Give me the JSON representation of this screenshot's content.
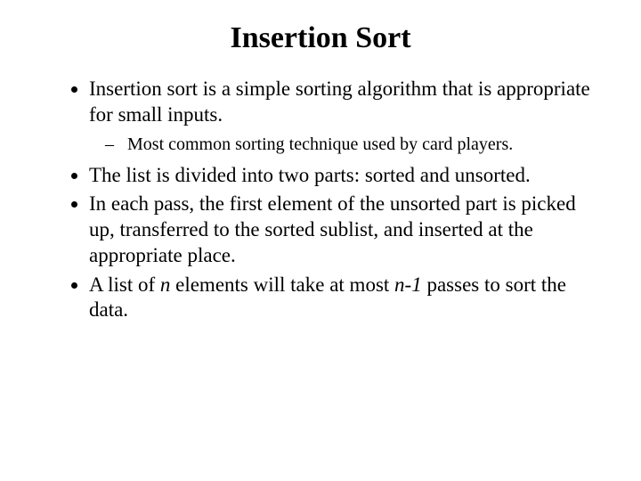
{
  "title": "Insertion Sort",
  "bullets": {
    "b1": "Insertion sort is a simple sorting algorithm that is appropriate for small inputs.",
    "b1_sub": "Most common sorting technique used by card players.",
    "b2": "The list is divided into two parts: sorted and unsorted.",
    "b3": "In each pass, the first element of the unsorted part is picked up, transferred to the sorted sublist, and inserted at the appropriate place.",
    "b4_pre": "A list of ",
    "b4_n": "n",
    "b4_mid": " elements will take at most ",
    "b4_n1": "n-1",
    "b4_post": " passes to sort the data."
  }
}
